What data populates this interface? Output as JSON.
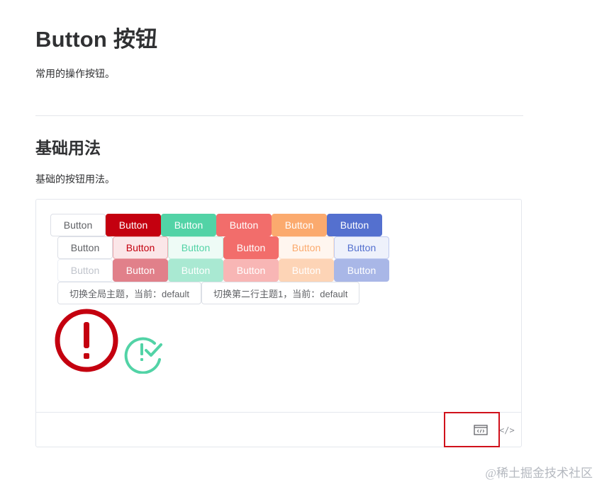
{
  "page": {
    "title": "Button 按钮",
    "subtitle": "常用的操作按钮。",
    "section_title": "基础用法",
    "section_desc": "基础的按钮用法。"
  },
  "rows": [
    [
      {
        "label": "Button",
        "bg": "#ffffff",
        "color": "#606266",
        "border": "#dcdfe6"
      },
      {
        "label": "Button",
        "bg": "#c4000f",
        "color": "#ffffff",
        "border": "#c4000f"
      },
      {
        "label": "Button",
        "bg": "#52d3a6",
        "color": "#ffffff",
        "border": "#52d3a6"
      },
      {
        "label": "Button",
        "bg": "#f26d6b",
        "color": "#ffffff",
        "border": "#f26d6b"
      },
      {
        "label": "Button",
        "bg": "#fbaa6e",
        "color": "#ffffff",
        "border": "#fbaa6e"
      },
      {
        "label": "Button",
        "bg": "#5470cf",
        "color": "#ffffff",
        "border": "#5470cf"
      }
    ],
    [
      {
        "label": "Button",
        "bg": "#ffffff",
        "color": "#606266",
        "border": "#dcdfe6"
      },
      {
        "label": "Button",
        "bg": "#fbe6e8",
        "color": "#c4000f",
        "border": "#eba9ae"
      },
      {
        "label": "Button",
        "bg": "#eefbf6",
        "color": "#52d3a6",
        "border": "#c5efdf"
      },
      {
        "label": "Button",
        "bg": "#f26d6b",
        "color": "#ffffff",
        "border": "#f26d6b"
      },
      {
        "label": "Button",
        "bg": "#fff6ef",
        "color": "#fbaa6e",
        "border": "#fde3cf"
      },
      {
        "label": "Button",
        "bg": "#eef1fb",
        "color": "#5470cf",
        "border": "#bfcaf0"
      }
    ],
    [
      {
        "label": "Button",
        "bg": "#ffffff",
        "color": "#c0c4cc",
        "border": "#ebeef5"
      },
      {
        "label": "Button",
        "bg": "#e1808a",
        "color": "#ffffff",
        "border": "#e1808a"
      },
      {
        "label": "Button",
        "bg": "#a9e9d2",
        "color": "#ffffff",
        "border": "#a9e9d2"
      },
      {
        "label": "Button",
        "bg": "#f8b6b5",
        "color": "#ffffff",
        "border": "#f8b6b5"
      },
      {
        "label": "Button",
        "bg": "#fdd4b6",
        "color": "#ffffff",
        "border": "#fdd4b6"
      },
      {
        "label": "Button",
        "bg": "#a9b7e7",
        "color": "#ffffff",
        "border": "#a9b7e7"
      }
    ]
  ],
  "theme_buttons": {
    "global_theme": "切换全局主题，当前：default",
    "row_theme": "切换第二行主题1，当前：default"
  },
  "icons": {
    "alert": {
      "name": "exclamation-circle-icon",
      "color": "#c4000f"
    },
    "check": {
      "name": "exclamation-check-icon",
      "color": "#52d3a6"
    },
    "code": "code-preview-icon",
    "expand": "</>"
  },
  "watermark": "@稀土掘金技术社区"
}
